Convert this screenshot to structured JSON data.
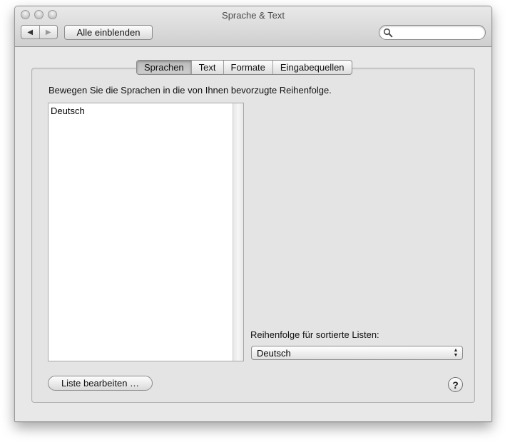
{
  "window": {
    "title": "Sprache & Text"
  },
  "toolbar": {
    "back_icon": "◀",
    "forward_icon": "▶",
    "show_all_label": "Alle einblenden",
    "search": {
      "value": "",
      "placeholder": ""
    }
  },
  "tabs": [
    {
      "label": "Sprachen",
      "active": true
    },
    {
      "label": "Text",
      "active": false
    },
    {
      "label": "Formate",
      "active": false
    },
    {
      "label": "Eingabequellen",
      "active": false
    }
  ],
  "languages_pane": {
    "instruction": "Bewegen Sie die Sprachen in die von Ihnen bevorzugte Reihenfolge.",
    "languages": [
      "Deutsch"
    ],
    "sort_order_label": "Reihenfolge für sortierte Listen:",
    "sort_order_value": "Deutsch",
    "edit_list_label": "Liste bearbeiten …",
    "help_label": "?"
  },
  "icons": {
    "search": "search-icon",
    "back": "back-arrow-icon",
    "forward": "forward-arrow-icon",
    "help": "help-icon"
  }
}
